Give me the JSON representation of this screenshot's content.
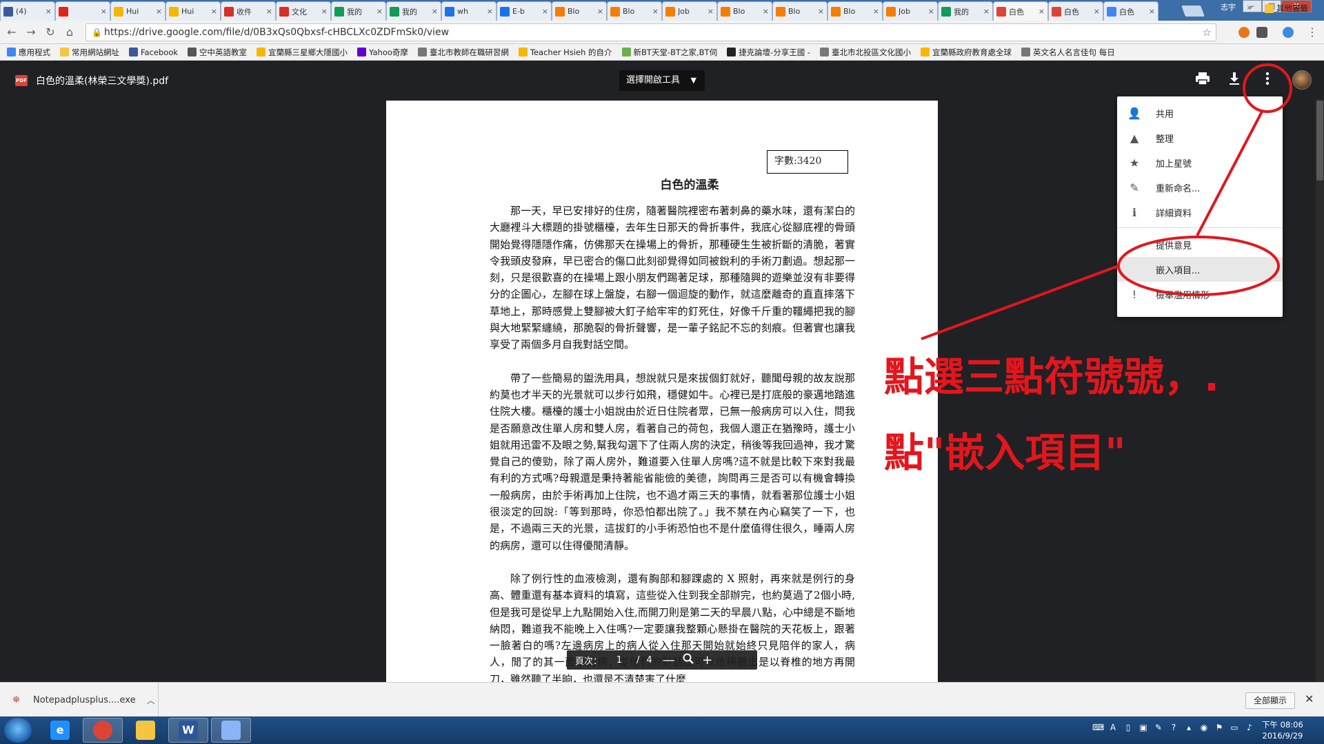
{
  "browser": {
    "tabs": [
      {
        "label": "(4)",
        "icon": "facebook-icon",
        "color": "#3b5998"
      },
      {
        "label": "",
        "icon": "youtube-icon",
        "color": "#e62117"
      },
      {
        "label": "Hui",
        "icon": "yahoo-icon",
        "color": "#f5b700"
      },
      {
        "label": "Hui",
        "icon": "yahoo-icon",
        "color": "#f5b700"
      },
      {
        "label": "收件",
        "icon": "gmail-icon",
        "color": "#d93025"
      },
      {
        "label": "文化",
        "icon": "gmail-icon",
        "color": "#d93025"
      },
      {
        "label": "我的",
        "icon": "drive-icon",
        "color": "#0f9d58"
      },
      {
        "label": "我的",
        "icon": "drive-icon",
        "color": "#0f9d58"
      },
      {
        "label": "wh",
        "icon": "page-icon",
        "color": "#1a73e8"
      },
      {
        "label": "E-b",
        "icon": "page-icon",
        "color": "#1a73e8"
      },
      {
        "label": "Blo",
        "icon": "blogger-icon",
        "color": "#f57d00"
      },
      {
        "label": "Blo",
        "icon": "blogger-icon",
        "color": "#f57d00"
      },
      {
        "label": "Job",
        "icon": "blogger-icon",
        "color": "#f57d00"
      },
      {
        "label": "Blo",
        "icon": "blogger-icon",
        "color": "#f57d00"
      },
      {
        "label": "Blo",
        "icon": "blogger-icon",
        "color": "#f57d00"
      },
      {
        "label": "Blo",
        "icon": "blogger-icon",
        "color": "#f57d00"
      },
      {
        "label": "Job",
        "icon": "blogger-icon",
        "color": "#f57d00"
      },
      {
        "label": "我的",
        "icon": "drive-icon",
        "color": "#0f9d58"
      },
      {
        "label": "白色",
        "icon": "pdf-icon",
        "color": "#db4437",
        "active": true
      },
      {
        "label": "白色",
        "icon": "pdf-icon",
        "color": "#db4437"
      },
      {
        "label": "白色",
        "icon": "docs-icon",
        "color": "#4285f4"
      }
    ],
    "user_name": "志宇",
    "url": "https://drive.google.com/file/d/0B3xQs0Qbxsf-cHBCLXc0ZDFmSk0/view"
  },
  "bookmarks": {
    "items": [
      {
        "label": "應用程式",
        "icon": "apps-icon",
        "color": "#4285f4"
      },
      {
        "label": "常用網站網址",
        "icon": "folder-icon",
        "color": "#f4c542"
      },
      {
        "label": "Facebook",
        "icon": "facebook-icon",
        "color": "#3b5998"
      },
      {
        "label": "空中英語教室",
        "icon": "globe-icon",
        "color": "#555555"
      },
      {
        "label": "宜蘭縣三星鄉大隱國小",
        "icon": "yahoo-icon",
        "color": "#f5b700"
      },
      {
        "label": "Yahoo奇摩",
        "icon": "yahoo-icon",
        "color": "#5f01d1"
      },
      {
        "label": "臺北市教師在職研習網",
        "icon": "page-icon",
        "color": "#777777"
      },
      {
        "label": "Teacher Hsieh 的自介",
        "icon": "yahoo-icon",
        "color": "#f5b700"
      },
      {
        "label": "新BT天堂-BT之家,BT伺",
        "icon": "leaf-icon",
        "color": "#6ab04c"
      },
      {
        "label": "捷克論壇-分享王國 -",
        "icon": "jk-icon",
        "color": "#222222"
      },
      {
        "label": "臺北市北投區文化國小",
        "icon": "page-icon",
        "color": "#777777"
      },
      {
        "label": "宜蘭縣政府教育處全球",
        "icon": "yahoo-icon",
        "color": "#f5b700"
      },
      {
        "label": "英文名人名言佳句 每日",
        "icon": "page-icon",
        "color": "#777777"
      }
    ],
    "more": "»",
    "other_label": "其他書籤"
  },
  "viewer": {
    "file_title": "白色的溫柔(林榮三文學獎).pdf",
    "open_with_label": "選擇開啟工具",
    "icons": [
      "print-icon",
      "download-icon",
      "more-vert-icon"
    ]
  },
  "document": {
    "word_count": "字數:3420",
    "title": "白色的溫柔",
    "paragraphs": [
      "那一天，早已安排好的住房，隨著醫院裡密布著刺鼻的藥水味，還有潔白的大廳裡斗大標題的掛號櫃檯，去年生日那天的骨折事件，我底心從腳底裡的骨頭開始覺得隱隱作痛，仿佛那天在操場上的骨折，那種硬生生被折斷的清脆，著實令我頭皮發麻，早已密合的傷口此刻卻覺得如同被銳利的手術刀劃過。想起那一刻，只是很歡喜的在操場上跟小朋友們踢著足球，那種隨興的遊樂並沒有非要得分的企圖心，左腳在球上盤旋，右腳一個迴旋的動作，就這麼離奇的直直摔落下草地上，那時感覺上雙腳被大釘子給牢牢的釘死住，好像千斤重的韁繩把我的腳與大地緊緊纏繞，那脆裂的骨折聲響，是一輩子銘記不忘的刻痕。但著實也讓我享受了兩個多月自我對話空間。",
      "帶了一些簡易的盥洗用具，想說就只是來拔個釘就好，聽聞母親的故友說那約莫也才半天的光景就可以步行如飛，穩健如牛。心裡已是打底般的豪邁地踏進住院大樓。櫃檯的護士小姐說由於近日住院者眾，已無一般病房可以入住，問我是否願意改住單人房和雙人房，看著自己的荷包，我個人還正在猶豫時，護士小姐就用迅雷不及眼之勢,幫我勾選下了住兩人房的決定，稍後等我回過神，我才驚覺自己的傻勁，除了兩人房外，難道要入住單人房嗎?這不就是比較下來對我最有利的方式嗎?母親還是秉持著能省能儉的美德，詢問再三是否可以有機會轉換一般病房，由於手術再加上住院，也不過才兩三天的事情，就看著那位護士小姐很淡定的回說:「等到那時，你恐怕都出院了。」我不禁在內心竊笑了一下，也是，不過兩三天的光景，這拔釘的小手術恐怕也不是什麼值得住很久，睡兩人房的病房，還可以住得優閒清靜。",
      "除了例行性的血液檢測，還有胸部和腳踝處的 X 照射，再來就是例行的身高、體重還有基本資料的填寫，這些從入住到我全部辦完，也約莫過了2個小時,但是我可是從早上九點開始入住,而開刀則是第二天的早晨八點，心中總是不斷地納悶，難道我不能晚上入住嗎?一定要讓我整顆心懸掛在醫院的天花板上，跟著一臉著白的嗎?左邊病房上的病人從入住那天開始就始終只見陪伴的家人，病人，閒了的其一面小的病，從他們的對話出可以依稀聽出是以脊椎的地方再開刀，雖然聽了半晌，也還是不清楚害了什麼"
    ]
  },
  "page_controls": {
    "label": "頁次：",
    "current": "1",
    "separator": "/",
    "total": "4",
    "zoom_out": "—",
    "zoom_in": "+"
  },
  "menu": {
    "items": [
      {
        "label": "共用",
        "icon": "person-add-icon"
      },
      {
        "label": "整理",
        "icon": "drive-folder-icon"
      },
      {
        "label": "加上星號",
        "icon": "star-icon"
      },
      {
        "label": "重新命名...",
        "icon": "rename-icon"
      },
      {
        "label": "詳細資料",
        "icon": "info-icon"
      },
      {
        "label": "提供意見",
        "icon": ""
      },
      {
        "label": "嵌入項目...",
        "icon": "",
        "hover": true
      },
      {
        "label": "檢舉濫用情形",
        "icon": "report-icon"
      }
    ]
  },
  "annotation": {
    "line1": "點選三點符號號，.",
    "line2": "點\"嵌入項目\"",
    "color": "#e3161d"
  },
  "download_bar": {
    "file_name": "Notepadplusplus....exe",
    "show_all": "全部顯示"
  },
  "taskbar": {
    "apps": [
      {
        "name": "ie-icon",
        "glyph": "e",
        "color": "#1e90ff"
      },
      {
        "name": "chrome-icon",
        "glyph": "",
        "color": "#db4437",
        "active": true
      },
      {
        "name": "file-explorer-icon",
        "glyph": "",
        "color": "#f4c542"
      },
      {
        "name": "word-icon",
        "glyph": "W",
        "color": "#2b579a",
        "active": true
      },
      {
        "name": "paint-icon",
        "glyph": "",
        "color": "#8ab4f8",
        "active": true
      }
    ],
    "clock_time": "下午 08:06",
    "clock_date": "2016/9/29"
  }
}
